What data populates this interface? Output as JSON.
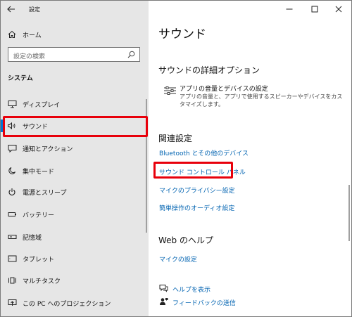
{
  "window": {
    "title": "設定"
  },
  "sidebar": {
    "home_label": "ホーム",
    "search_placeholder": "設定の検索",
    "section_title": "システム",
    "items": [
      {
        "label": "ディスプレイ",
        "icon": "display-icon"
      },
      {
        "label": "サウンド",
        "icon": "speaker-icon",
        "selected": true
      },
      {
        "label": "通知とアクション",
        "icon": "notification-icon"
      },
      {
        "label": "集中モード",
        "icon": "moon-icon"
      },
      {
        "label": "電源とスリープ",
        "icon": "power-icon"
      },
      {
        "label": "バッテリー",
        "icon": "battery-icon"
      },
      {
        "label": "記憶域",
        "icon": "storage-icon"
      },
      {
        "label": "タブレット",
        "icon": "tablet-icon"
      },
      {
        "label": "マルチタスク",
        "icon": "multitask-icon"
      },
      {
        "label": "この PC へのプロジェクション",
        "icon": "projection-icon"
      }
    ]
  },
  "main": {
    "page_title": "サウンド",
    "advanced": {
      "heading": "サウンドの詳細オプション",
      "item_title": "アプリの音量とデバイスの設定",
      "item_desc": "アプリの音量と、アプリで使用するスピーカーやデバイスをカスタマイズします。"
    },
    "related": {
      "heading": "関連設定",
      "links": [
        "Bluetooth とその他のデバイス",
        "サウンド コントロール パネル",
        "マイクのプライバシー設定",
        "簡単操作のオーディオ設定"
      ]
    },
    "web_help": {
      "heading": "Web のヘルプ",
      "link": "マイクの設定"
    },
    "footer": {
      "help_label": "ヘルプを表示",
      "feedback_label": "フィードバックの送信"
    }
  },
  "colors": {
    "accent": "#0078d7",
    "link": "#0063b1",
    "highlight": "#e8000b",
    "sidebar_bg": "#e6e6e6"
  }
}
